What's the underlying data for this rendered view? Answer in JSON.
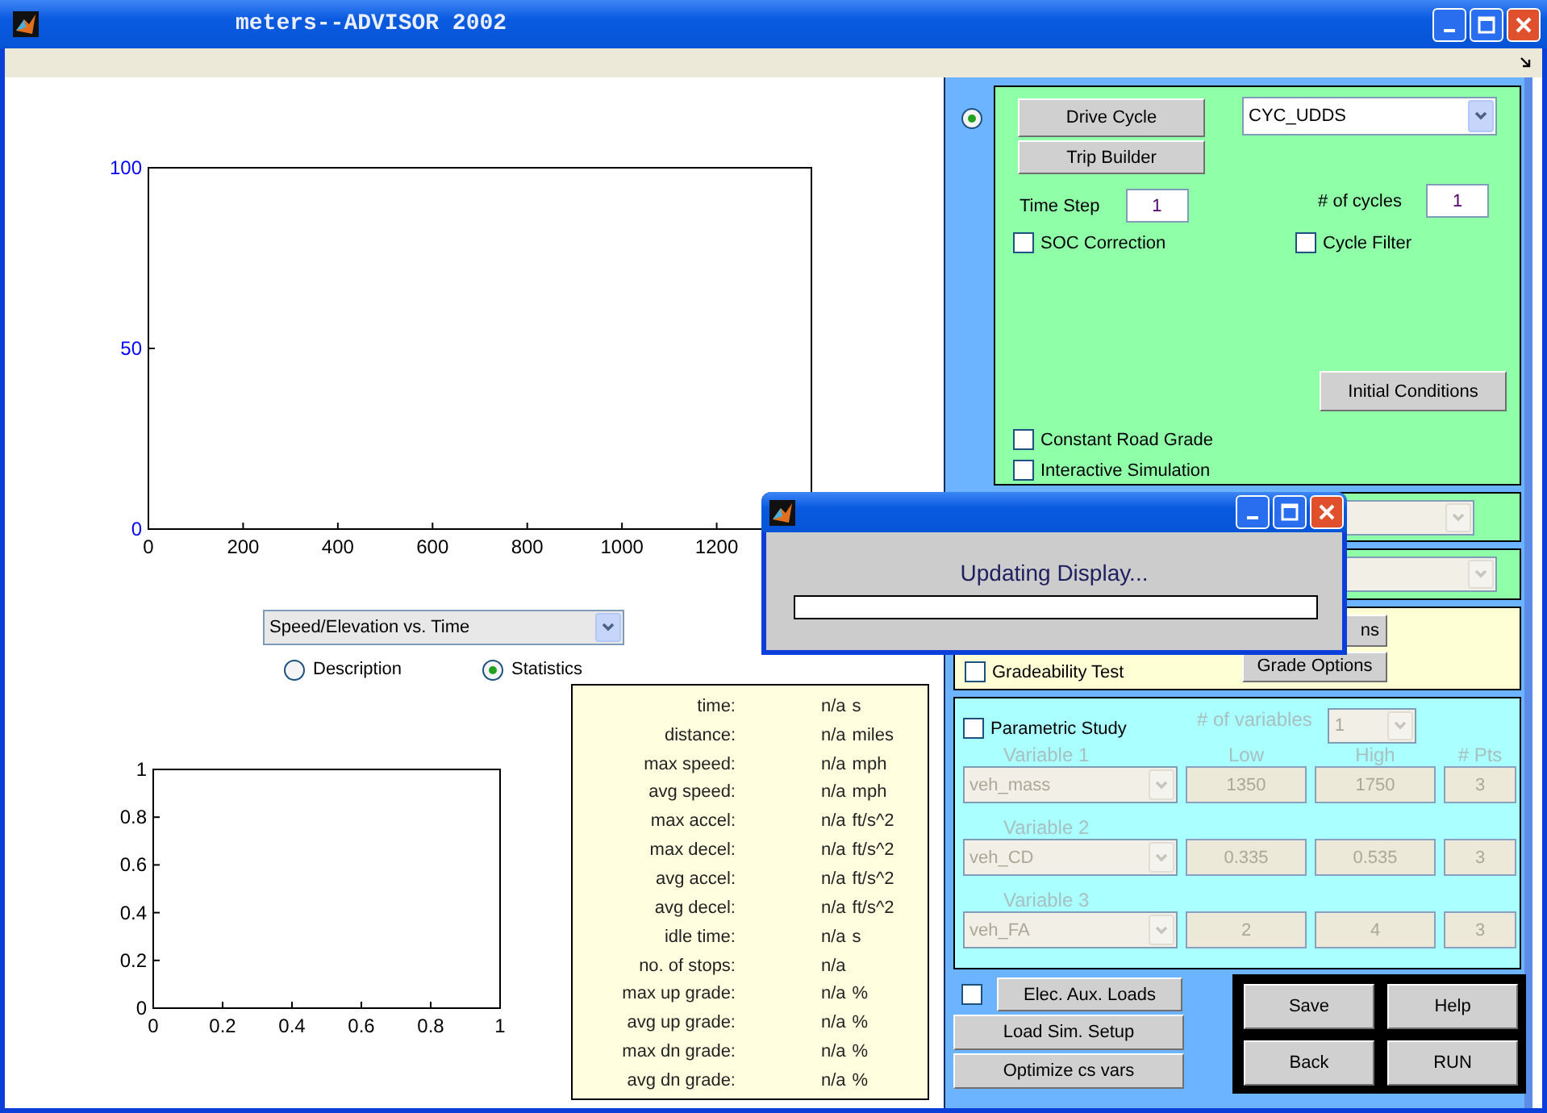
{
  "window": {
    "title": "meters--ADVISOR 2002"
  },
  "top_chart": {
    "chart_data": {
      "type": "line",
      "xlim": [
        0,
        1400
      ],
      "ylim": [
        0,
        100
      ],
      "xticks": [
        0,
        200,
        400,
        600,
        800,
        1000,
        1200
      ],
      "yticks": [
        0,
        50,
        100
      ]
    }
  },
  "plot_menu": {
    "value": "Speed/Elevation vs. Time"
  },
  "view_options": [
    {
      "label": "Description",
      "selected": false
    },
    {
      "label": "Statistics",
      "selected": true
    }
  ],
  "bottom_chart": {
    "chart_data": {
      "type": "line",
      "xlim": [
        0,
        1
      ],
      "ylim": [
        0,
        1
      ],
      "xticks": [
        0,
        0.2,
        0.4,
        0.6,
        0.8,
        1
      ],
      "yticks": [
        0,
        0.2,
        0.4,
        0.6,
        0.8,
        1
      ]
    }
  },
  "statistics": [
    {
      "label": "time:",
      "value": "n/a",
      "unit": "s"
    },
    {
      "label": "distance:",
      "value": "n/a",
      "unit": "miles"
    },
    {
      "label": "max speed:",
      "value": "n/a",
      "unit": "mph"
    },
    {
      "label": "avg speed:",
      "value": "n/a",
      "unit": "mph"
    },
    {
      "label": "max accel:",
      "value": "n/a",
      "unit": "ft/s^2"
    },
    {
      "label": "max decel:",
      "value": "n/a",
      "unit": "ft/s^2"
    },
    {
      "label": "avg accel:",
      "value": "n/a",
      "unit": "ft/s^2"
    },
    {
      "label": "avg decel:",
      "value": "n/a",
      "unit": "ft/s^2"
    },
    {
      "label": "idle time:",
      "value": "n/a",
      "unit": "s"
    },
    {
      "label": "no. of stops:",
      "value": "n/a"
    },
    {
      "label": "max up grade:",
      "value": "n/a",
      "unit": "%"
    },
    {
      "label": "avg up grade:",
      "value": "n/a",
      "unit": "%"
    },
    {
      "label": "max dn grade:",
      "value": "n/a",
      "unit": "%"
    },
    {
      "label": "avg dn grade:",
      "value": "n/a",
      "unit": "%"
    }
  ],
  "cycle_mode": {
    "selected": true
  },
  "drive_cycle": {
    "buttons": [
      "Drive Cycle",
      "Trip Builder"
    ],
    "cycle": "CYC_UDDS",
    "time_step_label": "Time Step",
    "time_step": "1",
    "cycles_label": "# of cycles",
    "cycles": "1",
    "options": [
      {
        "label": "SOC Correction",
        "checked": false
      },
      {
        "label": "Cycle Filter",
        "checked": false
      }
    ],
    "initial_conditions": "Initial Conditions",
    "extra_options": [
      {
        "label": "Constant Road Grade",
        "checked": false
      },
      {
        "label": "Interactive Simulation",
        "checked": false
      }
    ]
  },
  "grade": {
    "options_button": "ns",
    "test": {
      "label": "Gradeability Test",
      "checked": false
    },
    "grade_options": "Grade Options"
  },
  "parametric": {
    "label": "Parametric Study",
    "checked": false,
    "disabled": true,
    "count_label": "# of variables",
    "count": "1",
    "headers": [
      "Low",
      "High",
      "# Pts"
    ],
    "variables": [
      {
        "label": "Variable 1",
        "name": "veh_mass",
        "low": "1350",
        "high": "1750",
        "points": "3"
      },
      {
        "label": "Variable 2",
        "name": "veh_CD",
        "low": "0.335",
        "high": "0.535",
        "points": "3"
      },
      {
        "label": "Variable 3",
        "name": "veh_FA",
        "low": "2",
        "high": "4",
        "points": "3"
      }
    ]
  },
  "aux_loads": {
    "checked": false,
    "label": "Elec. Aux. Loads"
  },
  "setup_buttons": [
    "Load Sim. Setup",
    "Optimize cs vars"
  ],
  "actions": [
    "Save",
    "Help",
    "Back",
    "RUN"
  ],
  "dialog": {
    "message": "Updating Display...",
    "progress": {
      "level": 0
    }
  }
}
